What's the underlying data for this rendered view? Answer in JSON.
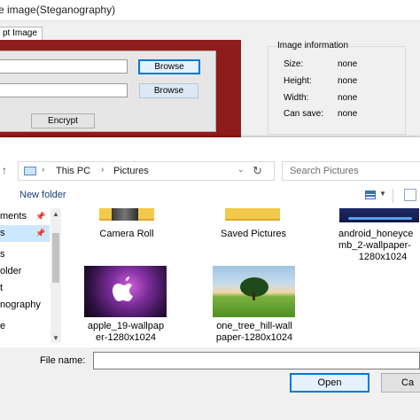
{
  "app": {
    "title": "e image(Steganography)",
    "tab_label": "pt Image",
    "browse1_label": "Browse",
    "browse2_label": "Browse",
    "encrypt_label": "Encrypt",
    "image_info": {
      "legend": "Image information",
      "rows": [
        {
          "label": "Size:",
          "value": "none"
        },
        {
          "label": "Height:",
          "value": "none"
        },
        {
          "label": "Width:",
          "value": "none"
        },
        {
          "label": "Can save:",
          "value": "none"
        }
      ]
    }
  },
  "dialog": {
    "breadcrumb": [
      "This PC",
      "Pictures"
    ],
    "search_placeholder": "Search Pictures",
    "new_folder_label": "New folder",
    "nav_items": [
      {
        "label": "ments",
        "pinned": true
      },
      {
        "label": "s",
        "pinned": true,
        "selected": true
      },
      {
        "label": "s",
        "pinned": false
      },
      {
        "label": "older",
        "pinned": false
      },
      {
        "label": "t",
        "pinned": false
      },
      {
        "label": "nography",
        "pinned": false
      },
      {
        "label": "e",
        "pinned": false
      }
    ],
    "files": [
      {
        "name": "Camera Roll",
        "kind": "folder"
      },
      {
        "name": "Saved Pictures",
        "kind": "folder"
      },
      {
        "name_lines": [
          "android_honeyce",
          "mb_2-wallpaper-",
          "1280x1024"
        ],
        "kind": "image"
      },
      {
        "name_lines": [
          "apple_19-wallpap",
          "er-1280x1024"
        ],
        "kind": "image"
      },
      {
        "name_lines": [
          "one_tree_hill-wall",
          "paper-1280x1024"
        ],
        "kind": "image"
      }
    ],
    "file_name_label": "File name:",
    "file_name_value": "",
    "open_label": "Open",
    "cancel_label": "Ca"
  },
  "colors": {
    "accent": "#0078d7",
    "panel_red": "#8e1c1a",
    "selection": "#cce8ff",
    "link": "#1c3d7a"
  }
}
